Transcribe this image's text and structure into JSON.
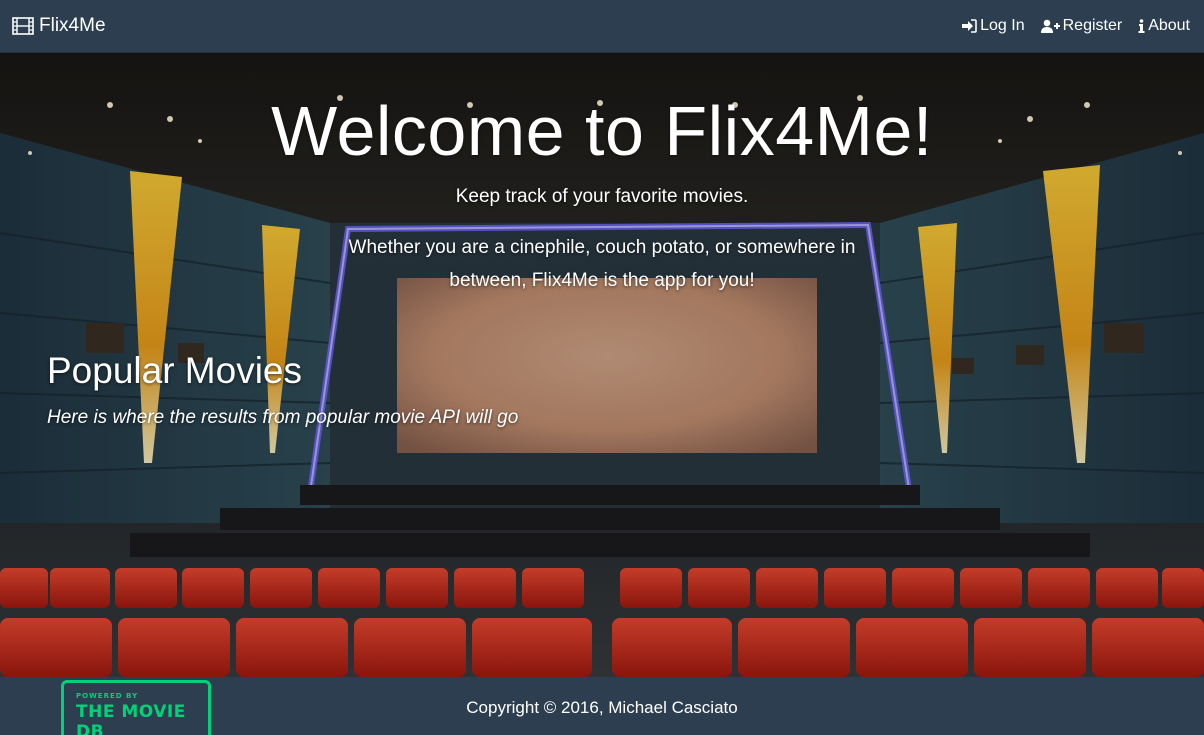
{
  "navbar": {
    "brand": "Flix4Me",
    "links": {
      "login": "Log In",
      "register": "Register",
      "about": "About"
    }
  },
  "hero": {
    "title": "Welcome to Flix4Me!",
    "tagline": "Keep track of your favorite movies.",
    "intro": "Whether you are a cinephile, couch potato, or somewhere in between, Flix4Me is the app for you!"
  },
  "popular": {
    "heading": "Popular Movies",
    "note": "Here is where the results from popular movie API will go"
  },
  "footer": {
    "logo_powered": "POWERED BY",
    "logo_name": "THE MOVIE DB",
    "copyright": "Copyright © 2016, Michael Casciato"
  },
  "icons": {
    "brand": "film-icon",
    "login": "sign-in-icon",
    "register": "user-plus-icon",
    "about": "info-icon"
  },
  "colors": {
    "navbar_bg": "#2c3e50",
    "footer_bg": "#2c3e50",
    "text": "#ffffff",
    "tmdb_green": "#01d277",
    "seat_red": "#d2271d",
    "neon_blue": "#6c63ff",
    "pillar_gold": "#f2b31f"
  }
}
